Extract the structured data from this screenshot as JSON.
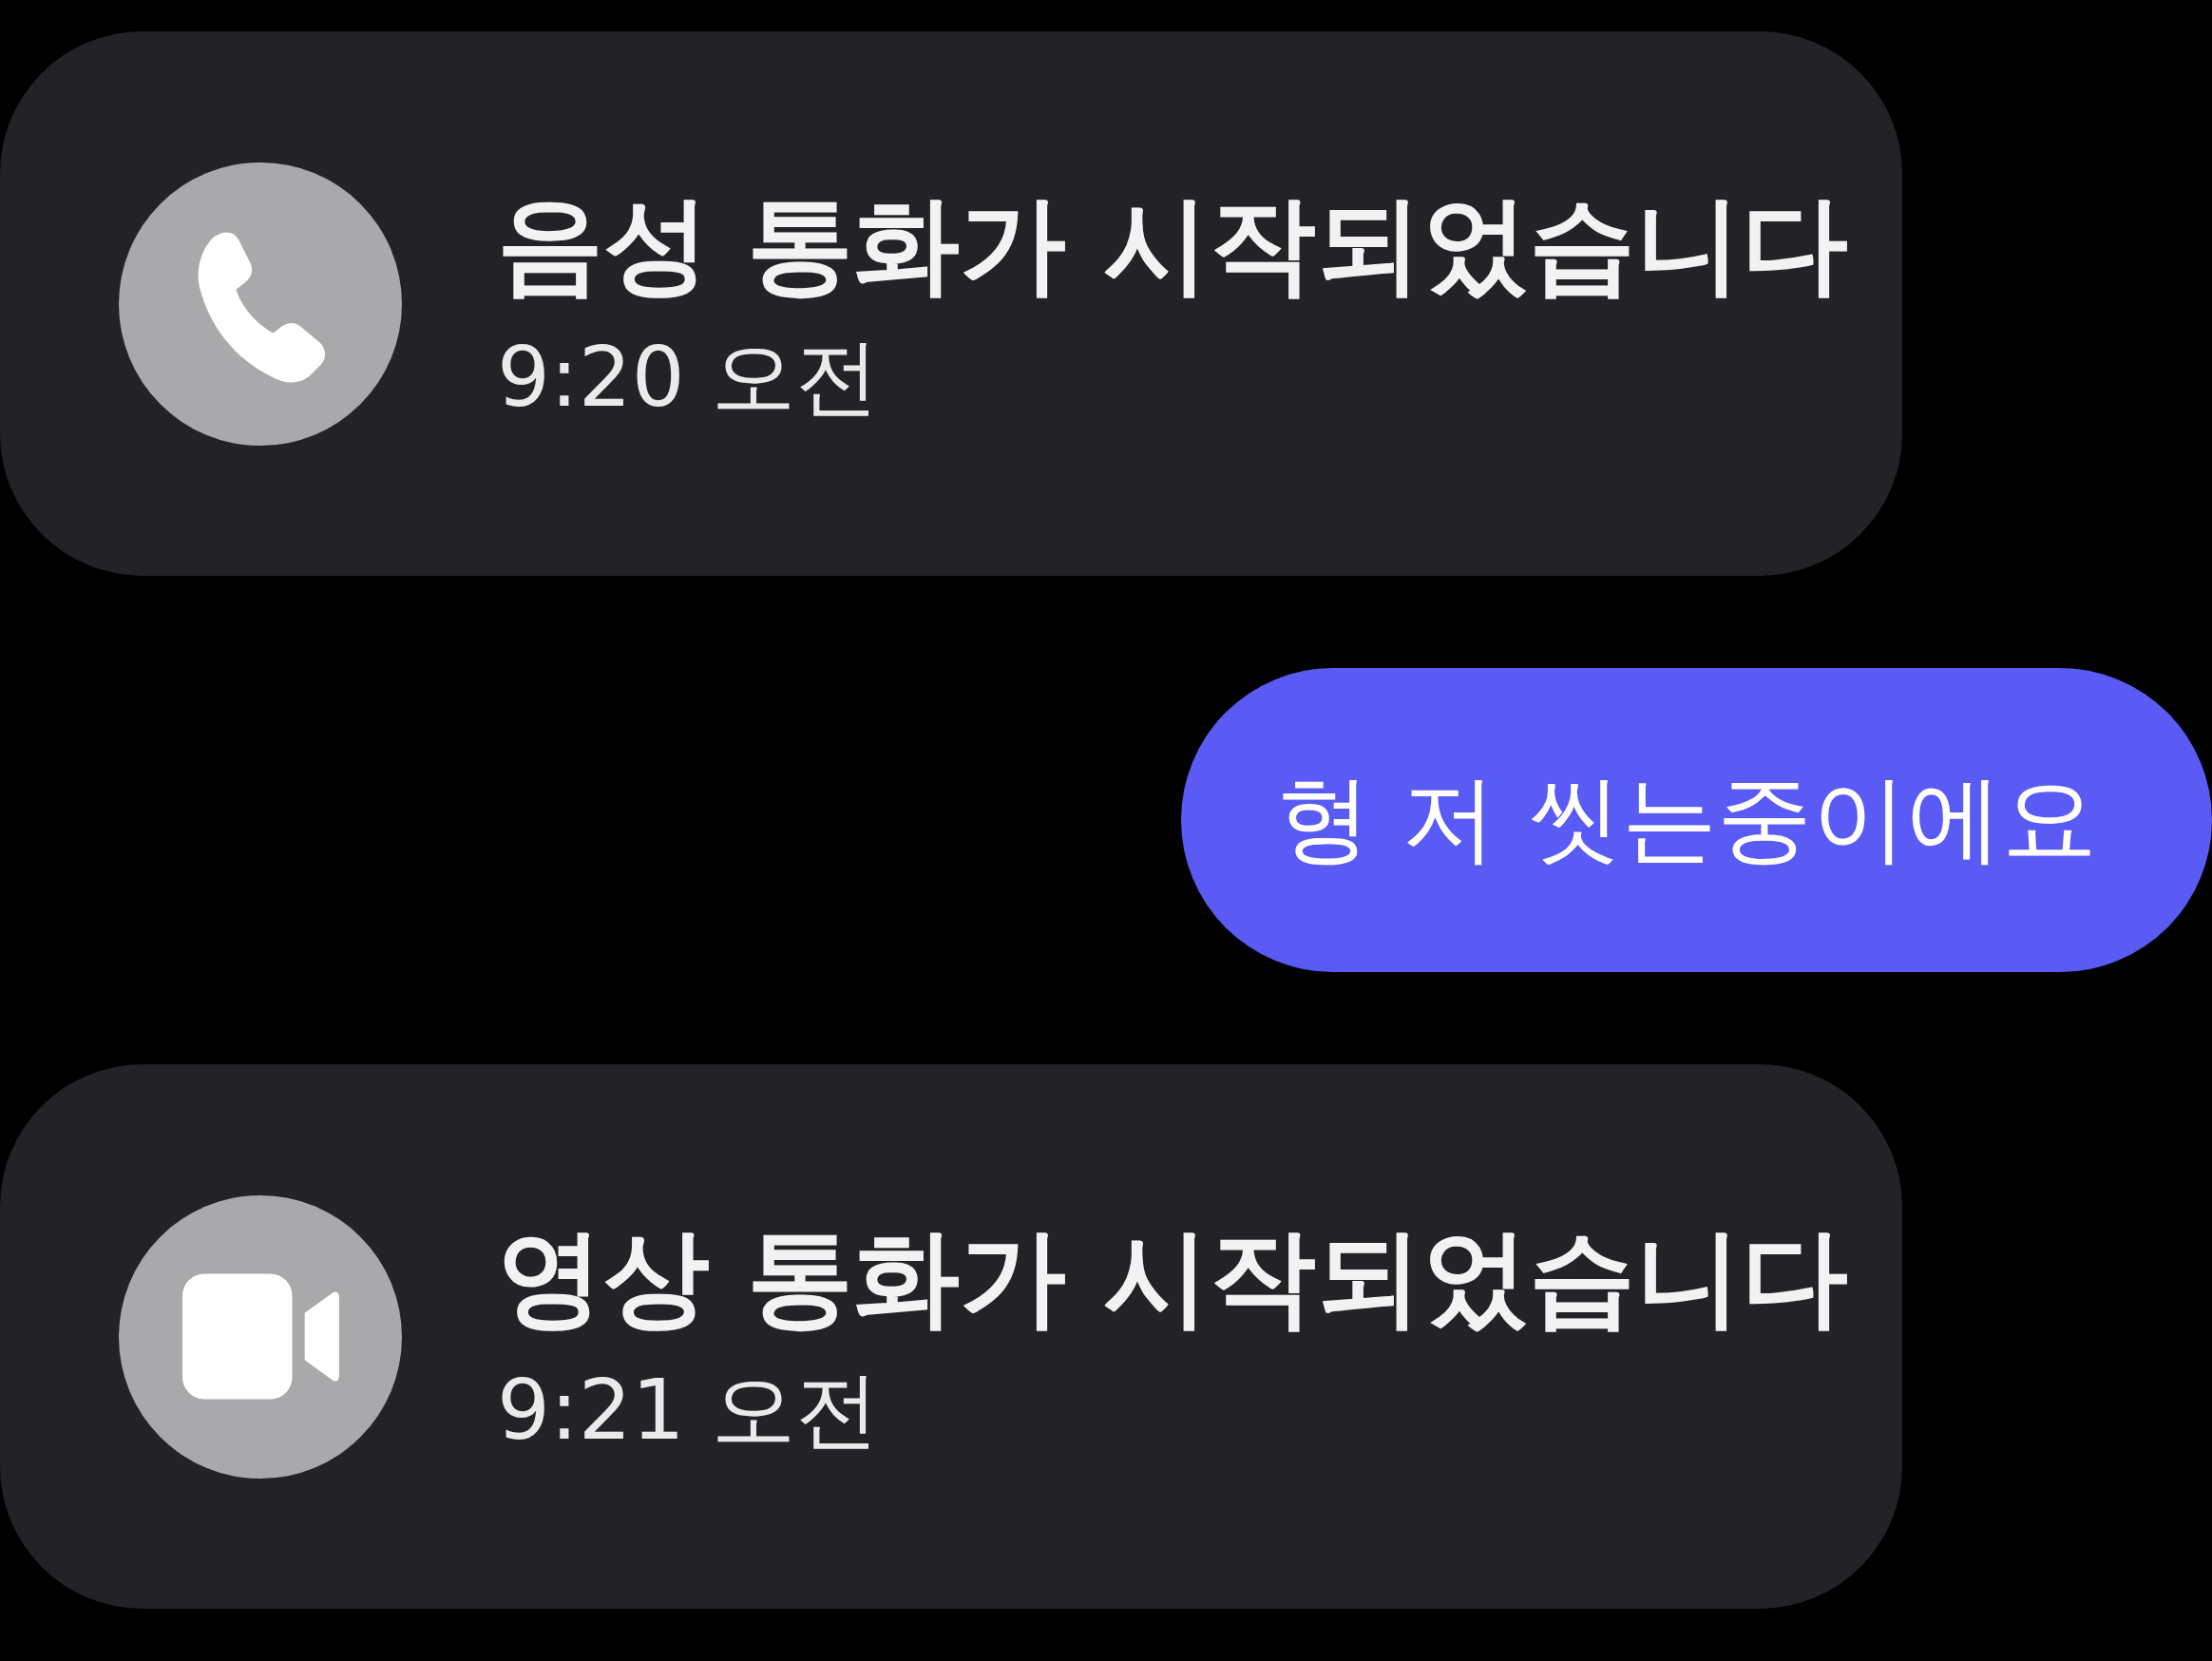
{
  "messages": [
    {
      "kind": "voice",
      "title": "음성 통화가 시작되었습니다",
      "time": "9:20 오전"
    },
    {
      "kind": "bubble",
      "outgoing": true,
      "text": "형 저 씻는중이에요"
    },
    {
      "kind": "video",
      "title": "영상 통화가 시작되었습니다",
      "time": "9:21 오전"
    }
  ]
}
